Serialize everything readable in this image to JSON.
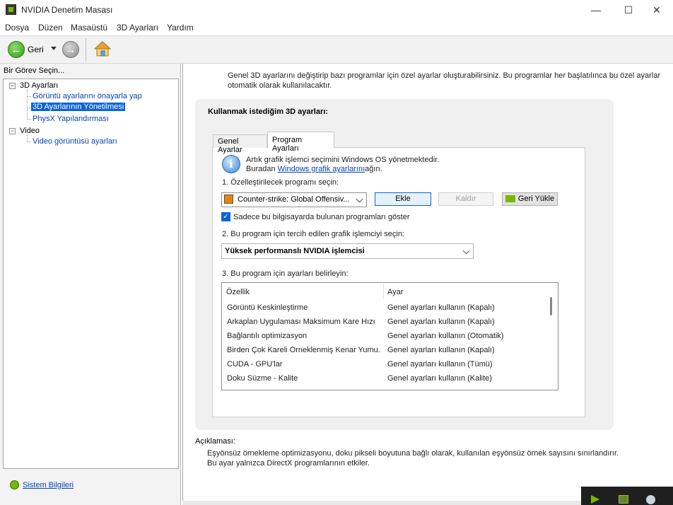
{
  "window": {
    "title": "NVIDIA Denetim Masası",
    "minimize": "—",
    "maximize": "☐",
    "close": "✕"
  },
  "menu": [
    "Dosya",
    "Düzen",
    "Masaüstü",
    "3D Ayarları",
    "Yardım"
  ],
  "toolbar": {
    "back_label": "Geri"
  },
  "left_pane": {
    "header": "Bir Görev Seçin...",
    "tree": {
      "group1": "3D Ayarları",
      "item1": "Görüntü ayarlarını önayarla yap",
      "item2": "3D Ayarlarının Yönetilmesi",
      "item3": "PhysX Yapılandırması",
      "group2": "Video",
      "item4": "Video görüntüsü ayarları"
    },
    "system_info": "Sistem Bilgileri"
  },
  "main": {
    "intro": "Genel 3D ayarlarını değiştirip bazı programlar için özel ayarlar oluşturabilirsiniz. Bu programlar her başlatılınca bu özel ayarlar otomatik olarak kullanılacaktır.",
    "panel_title": "Kullanmak istediğim 3D ayarları:",
    "tabs": [
      "Genel Ayarlar",
      "Program Ayarları"
    ],
    "info_line1": "Artık grafik işlemci seçimini Windows OS yönetmektedir.",
    "info_line2_pre": "Buradan ",
    "info_line2_link": "Windows grafik ayarlarını",
    "info_line2_post": "ağın.",
    "step1": "1. Özelleştirilecek programı seçin:",
    "program_selected": "Counter-strike: Global Offensiv...",
    "btn_add": "Ekle",
    "btn_remove": "Kaldır",
    "btn_restore": "Geri Yükle",
    "checkbox_label": "Sadece bu bilgisayarda bulunan programları göster",
    "step2": "2. Bu program için tercih edilen grafik işlemciyi seçin:",
    "gpu_selected": "Yüksek performanslı NVIDIA işlemcisi",
    "step3": "3. Bu program için ayarları belirleyin:",
    "table_headers": [
      "Özellik",
      "Ayar"
    ],
    "table_rows": [
      [
        "Görüntü Keskinleştirme",
        "Genel ayarları kullanın (Kapalı)"
      ],
      [
        "Arkaplan Uygulaması Maksimum Kare Hızı",
        "Genel ayarları kullanın (Kapalı)"
      ],
      [
        "Bağlantılı optimizasyon",
        "Genel ayarları kullanın (Otomatik)"
      ],
      [
        "Birden Çok Kareli Örneklenmiş Kenar Yumu...",
        "Genel ayarları kullanın (Kapalı)"
      ],
      [
        "CUDA - GPU'lar",
        "Genel ayarları kullanın (Tümü)"
      ],
      [
        "Doku Süzme - Kalite",
        "Genel ayarları kullanın (Kalite)"
      ]
    ],
    "desc_title": "Açıklaması:",
    "desc_text": "Eşyönsüz örnekleme optimizasyonu, doku pikseli boyutuna bağlı olarak, kullanılan eşyönsüz örnek sayısını sınırlandırır. Bu ayar yalnızca DirectX programlarının etkiler."
  },
  "colors": {
    "nvidia_green": "#76b900",
    "selection_blue": "#0a64d8",
    "link_blue": "#0645ad"
  }
}
